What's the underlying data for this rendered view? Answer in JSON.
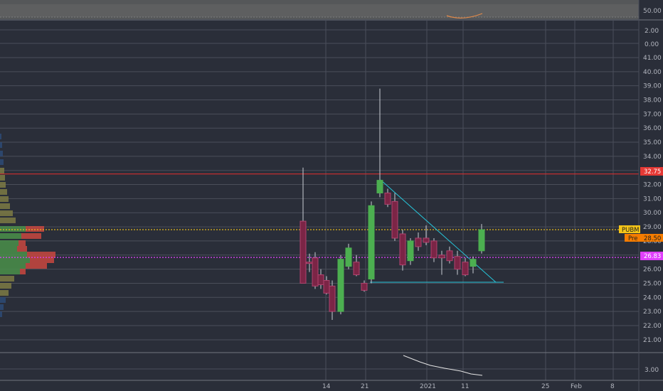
{
  "colors": {
    "background": "#2a2e39",
    "grid": "#4a4e5a",
    "axis_text": "#b2b5be",
    "up": "#4caf50",
    "down": "#7b2546",
    "down_edge": "#b0436e",
    "resistance": "#d32f2f",
    "pink_line": "#e040fb",
    "yellow_line": "#f5c518",
    "trendline": "#26c6da",
    "vp_up": "#4a8f4a",
    "vp_down": "#c9473f",
    "vp_upper": "#2d4a76",
    "vp_olive": "#7d7a44"
  },
  "axis": {
    "top_pane_tick": "50.00",
    "mid_pane_ticks": [
      "2.00",
      "0.00"
    ],
    "main_ticks": [
      "41.00",
      "40.00",
      "39.00",
      "38.00",
      "37.00",
      "36.00",
      "35.00",
      "34.00",
      "33.00",
      "32.00",
      "31.00",
      "30.00",
      "29.00",
      "28.00",
      "27.00",
      "26.00",
      "25.00",
      "24.00",
      "23.00",
      "22.00"
    ],
    "bottom_pane_ticks": [
      "21.00",
      "3.00"
    ]
  },
  "dates": {
    "labels": [
      "14",
      "21",
      "2021",
      "11",
      "25",
      "Feb",
      "8"
    ]
  },
  "tags": {
    "resistance": "32.75",
    "ticker": "PUBM",
    "pre_label": "Pre",
    "pre_value": "28.50",
    "pink": "26.83"
  },
  "chart_data": {
    "type": "candlestick",
    "title": "",
    "ylim": [
      21.5,
      41.5
    ],
    "candles": [
      {
        "x": 426,
        "o": 29.4,
        "h": 33.2,
        "l": 25.0,
        "c": 25.0
      },
      {
        "x": 435,
        "o": 26.5,
        "h": 27.1,
        "l": 25.8,
        "c": 26.4
      },
      {
        "x": 443,
        "o": 26.8,
        "h": 27.2,
        "l": 24.6,
        "c": 24.8
      },
      {
        "x": 451,
        "o": 25.6,
        "h": 26.0,
        "l": 24.6,
        "c": 24.9
      },
      {
        "x": 459,
        "o": 25.2,
        "h": 25.5,
        "l": 24.2,
        "c": 24.3
      },
      {
        "x": 467,
        "o": 24.8,
        "h": 25.2,
        "l": 22.4,
        "c": 23.0
      },
      {
        "x": 479,
        "o": 23.0,
        "h": 27.0,
        "l": 22.8,
        "c": 26.7
      },
      {
        "x": 490,
        "o": 26.2,
        "h": 27.8,
        "l": 26.0,
        "c": 27.5
      },
      {
        "x": 501,
        "o": 26.5,
        "h": 27.0,
        "l": 25.5,
        "c": 25.6
      },
      {
        "x": 512,
        "o": 25.0,
        "h": 25.2,
        "l": 24.4,
        "c": 24.5
      },
      {
        "x": 522,
        "o": 25.3,
        "h": 30.8,
        "l": 25.0,
        "c": 30.5
      },
      {
        "x": 534,
        "o": 31.4,
        "h": 38.8,
        "l": 31.1,
        "c": 32.3
      },
      {
        "x": 545,
        "o": 31.4,
        "h": 31.7,
        "l": 30.4,
        "c": 30.6
      },
      {
        "x": 555,
        "o": 30.8,
        "h": 31.4,
        "l": 28.0,
        "c": 28.2
      },
      {
        "x": 566,
        "o": 28.5,
        "h": 28.8,
        "l": 25.9,
        "c": 26.3
      },
      {
        "x": 577,
        "o": 26.6,
        "h": 28.2,
        "l": 26.3,
        "c": 28.0
      },
      {
        "x": 588,
        "o": 28.2,
        "h": 28.6,
        "l": 27.3,
        "c": 27.6
      },
      {
        "x": 599,
        "o": 28.2,
        "h": 29.1,
        "l": 27.7,
        "c": 27.9
      },
      {
        "x": 610,
        "o": 28.0,
        "h": 28.2,
        "l": 26.5,
        "c": 26.8
      },
      {
        "x": 621,
        "o": 27.0,
        "h": 27.3,
        "l": 25.6,
        "c": 26.8
      },
      {
        "x": 632,
        "o": 27.3,
        "h": 27.6,
        "l": 26.4,
        "c": 26.6
      },
      {
        "x": 643,
        "o": 26.9,
        "h": 27.3,
        "l": 25.6,
        "c": 26.0
      },
      {
        "x": 654,
        "o": 26.5,
        "h": 26.8,
        "l": 25.5,
        "c": 25.6
      },
      {
        "x": 665,
        "o": 26.2,
        "h": 26.9,
        "l": 25.7,
        "c": 26.7
      },
      {
        "x": 677,
        "o": 27.3,
        "h": 29.2,
        "l": 27.1,
        "c": 28.8
      }
    ],
    "horizontal_lines": [
      {
        "name": "resistance",
        "price": 32.75
      },
      {
        "name": "pre",
        "price": 28.8
      },
      {
        "name": "pink",
        "price": 26.83
      }
    ]
  }
}
